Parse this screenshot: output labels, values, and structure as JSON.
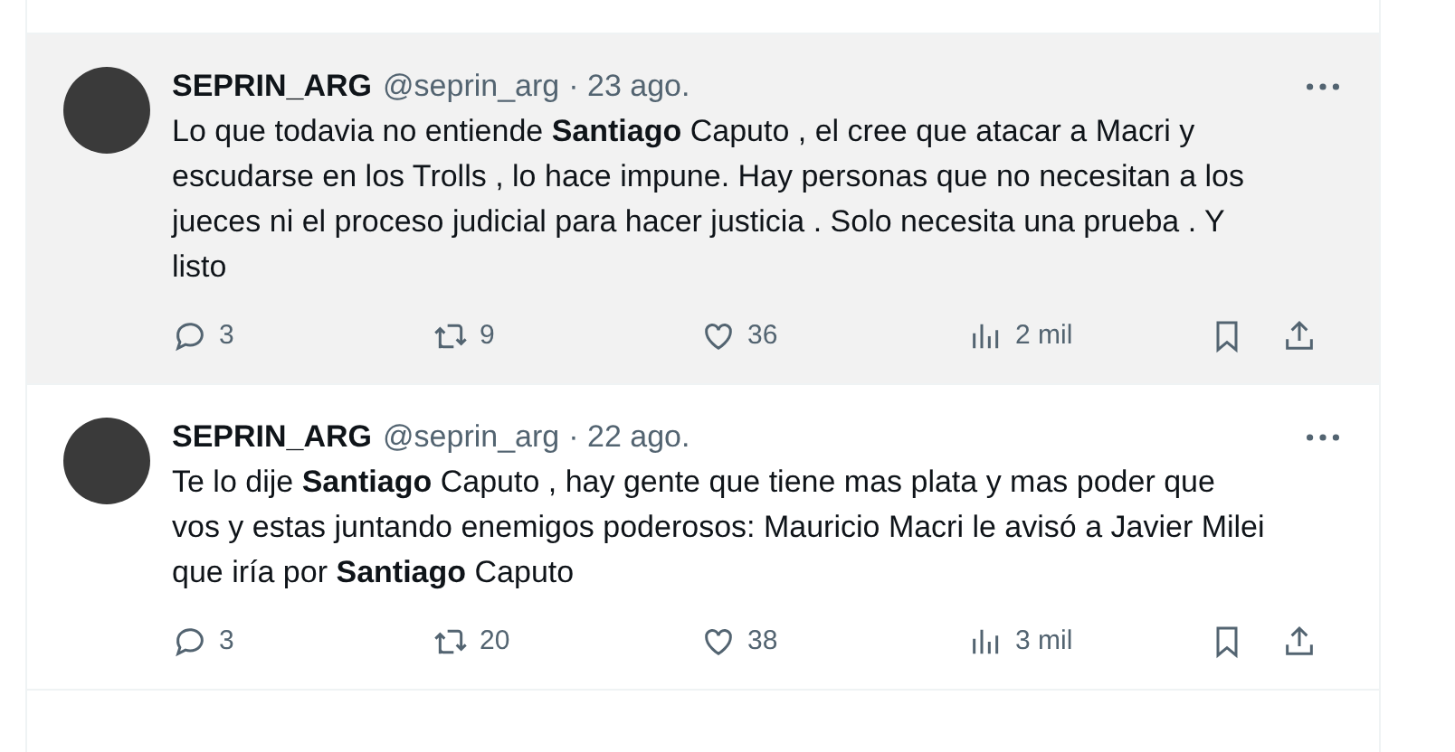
{
  "tweets": [
    {
      "name": "SEPRIN_ARG",
      "handle": "@seprin_arg",
      "date": "· 23 ago.",
      "hovered": true,
      "text": "Lo que todavia no entiende **Santiago** Caputo , el cree que atacar a Macri y escudarse en los Trolls , lo hace impune. Hay personas que  no necesitan a los jueces ni el proceso judicial para hacer justicia . Solo necesita una prueba . Y listo",
      "replies": "3",
      "reposts": "9",
      "likes": "36",
      "views": "2 mil"
    },
    {
      "name": "SEPRIN_ARG",
      "handle": "@seprin_arg",
      "date": "· 22 ago.",
      "hovered": false,
      "text": "Te lo dije **Santiago** Caputo , hay gente que tiene mas plata y mas poder que vos y estas juntando enemigos poderosos: Mauricio Macri le avisó a Javier Milei que iría por **Santiago** Caputo",
      "replies": "3",
      "reposts": "20",
      "likes": "38",
      "views": "3 mil"
    }
  ]
}
